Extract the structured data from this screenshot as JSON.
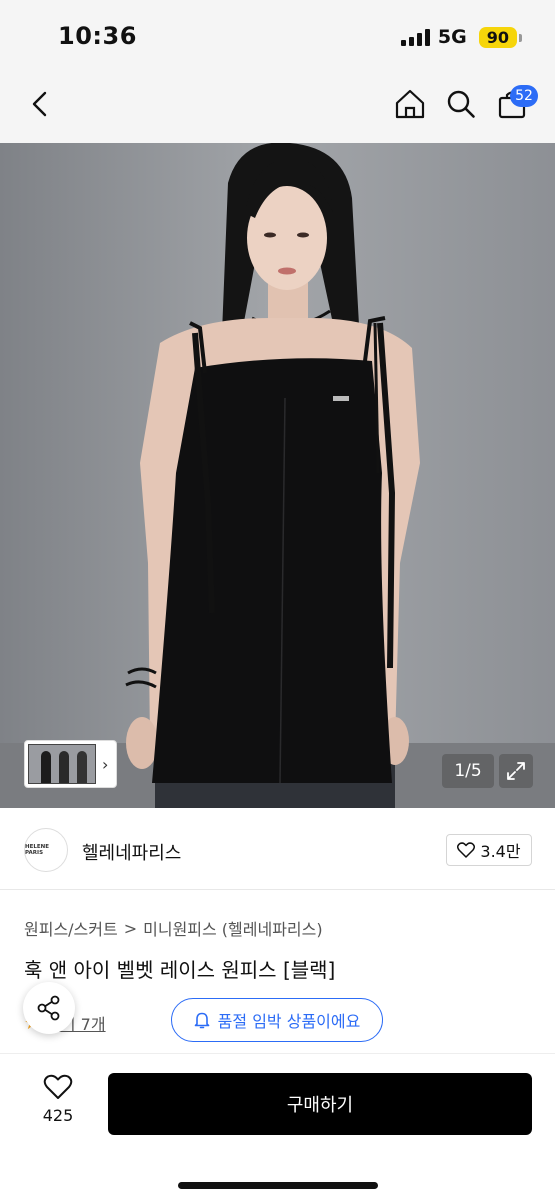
{
  "status_bar": {
    "time": "10:36",
    "network": "5G",
    "battery": "90"
  },
  "nav": {
    "cart_count": "52",
    "icons": [
      "back-icon",
      "home-icon",
      "search-icon",
      "cart-icon"
    ]
  },
  "gallery": {
    "counter": "1/5"
  },
  "brand": {
    "logo_text": "HELENE PARIS",
    "name": "헬레네파리스",
    "likes": "3.4만"
  },
  "breadcrumb": {
    "level1": "원피스/스커트",
    "separator": ">",
    "level2": "미니원피스 (헬레네파리스)"
  },
  "product": {
    "title": "훅 앤 아이 벨벳 레이스 원피스 [블랙]",
    "reviews": "후기 7개",
    "soldout_badge": "품절 임박 상품이에요"
  },
  "bottom": {
    "wish_count": "425",
    "buy_label": "구매하기"
  },
  "colors": {
    "accent": "#2c6cf6",
    "battery": "#f6d50a",
    "buy_button": "#000000",
    "star": "#f5a623"
  }
}
